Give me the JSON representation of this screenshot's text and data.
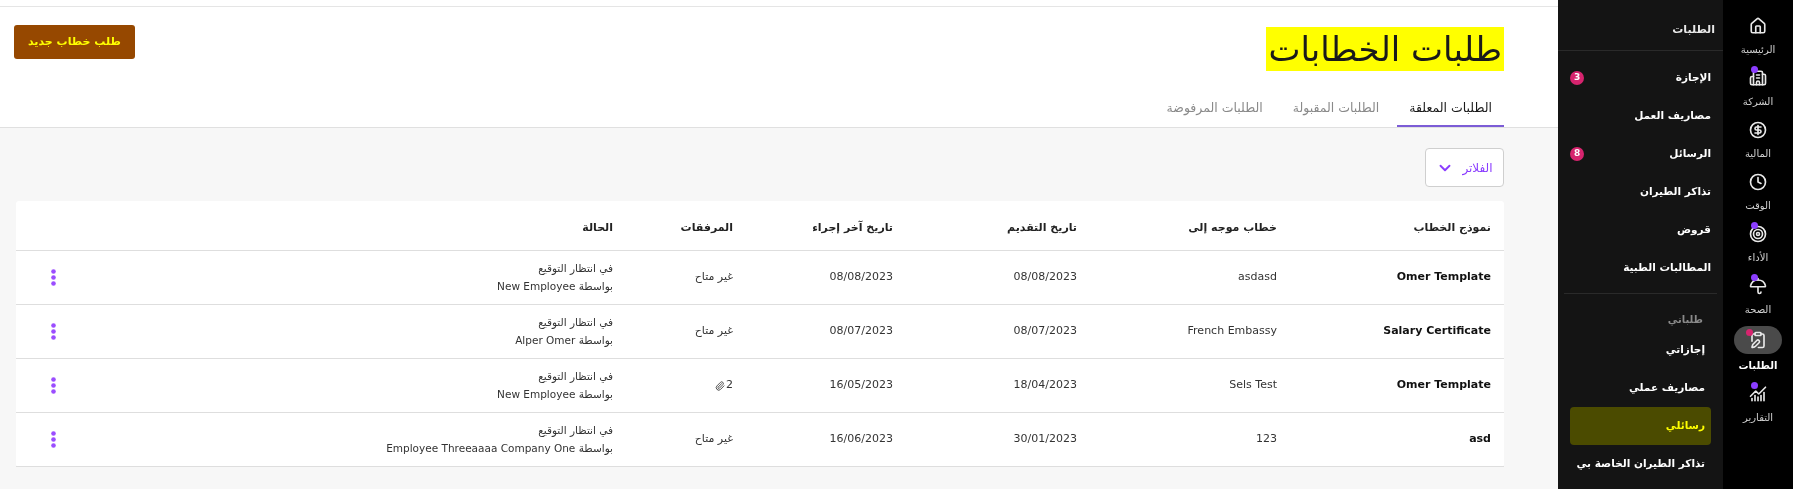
{
  "header": {
    "title": "طلبات الخطابات",
    "new_button": "طلب خطاب جديد"
  },
  "tabs": [
    {
      "label": "الطلبات المعلقة",
      "selected": true
    },
    {
      "label": "الطلبات المقبولة",
      "selected": false
    },
    {
      "label": "الطلبات المرفوضة",
      "selected": false
    }
  ],
  "filters_button": "الفلاتر",
  "table": {
    "columns": [
      "نموذج الخطاب",
      "خطاب موجه إلى",
      "تاريخ التقديم",
      "تاريخ آخر إجراء",
      "المرفقات",
      "الحالة"
    ],
    "rows": [
      {
        "template": "Omer Template",
        "addressed_to": "asdasd",
        "submitted": "08/08/2023",
        "last_action": "08/08/2023",
        "attachments": {
          "kind": "text",
          "text": "غير متاح"
        },
        "status": "في انتظار التوقيع",
        "by": "بواسطة New Employee"
      },
      {
        "template": "Salary Certificate",
        "addressed_to": "French Embassy",
        "submitted": "08/07/2023",
        "last_action": "08/07/2023",
        "attachments": {
          "kind": "text",
          "text": "غير متاح"
        },
        "status": "في انتظار التوقيع",
        "by": "بواسطة Alper Omer"
      },
      {
        "template": "Omer Template",
        "addressed_to": "Sels Test",
        "submitted": "18/04/2023",
        "last_action": "16/05/2023",
        "attachments": {
          "kind": "count",
          "text": "2"
        },
        "status": "في انتظار التوقيع",
        "by": "بواسطة New Employee"
      },
      {
        "template": "asd",
        "addressed_to": "123",
        "submitted": "30/01/2023",
        "last_action": "16/06/2023",
        "attachments": {
          "kind": "text",
          "text": "غير متاح"
        },
        "status": "في انتظار التوقيع",
        "by": "بواسطة Employee Threeaaaa Company One"
      }
    ]
  },
  "menu": {
    "title": "الطلبات",
    "sections": [
      {
        "items": [
          {
            "label": "الإجازة",
            "badge": "3",
            "selected": false
          },
          {
            "label": "مصاريف العمل",
            "selected": false
          },
          {
            "label": "الرسائل",
            "badge": "8",
            "selected": false
          },
          {
            "label": "تذاكر الطيران",
            "selected": false
          },
          {
            "label": "قروض",
            "selected": false
          },
          {
            "label": "المطالبات الطبية",
            "selected": false
          }
        ]
      },
      {
        "heading": "طلباتي",
        "items": [
          {
            "label": "إجازاتي",
            "selected": false
          },
          {
            "label": "مصاريف عملي",
            "selected": false
          },
          {
            "label": "رسائلي",
            "selected": true
          },
          {
            "label": "تذاكر الطيران الخاصة بي",
            "selected": false
          }
        ]
      }
    ]
  },
  "rail": [
    {
      "kind": "home",
      "label": "الرئيسية",
      "selected": false
    },
    {
      "kind": "company",
      "label": "الشركة",
      "selected": false,
      "color": "#8b3dff"
    },
    {
      "kind": "finance",
      "label": "المالية",
      "selected": false
    },
    {
      "kind": "time",
      "label": "الوقت",
      "selected": false
    },
    {
      "kind": "performance",
      "label": "الأداء",
      "selected": false,
      "color": "#8b3dff"
    },
    {
      "kind": "health",
      "label": "الصحة",
      "selected": false,
      "color": "#8b3dff"
    },
    {
      "kind": "requests",
      "label": "الطلبات",
      "selected": true,
      "color": "#d6246e"
    },
    {
      "kind": "reports",
      "label": "التقارير",
      "selected": false,
      "color": "#8b3dff"
    }
  ]
}
